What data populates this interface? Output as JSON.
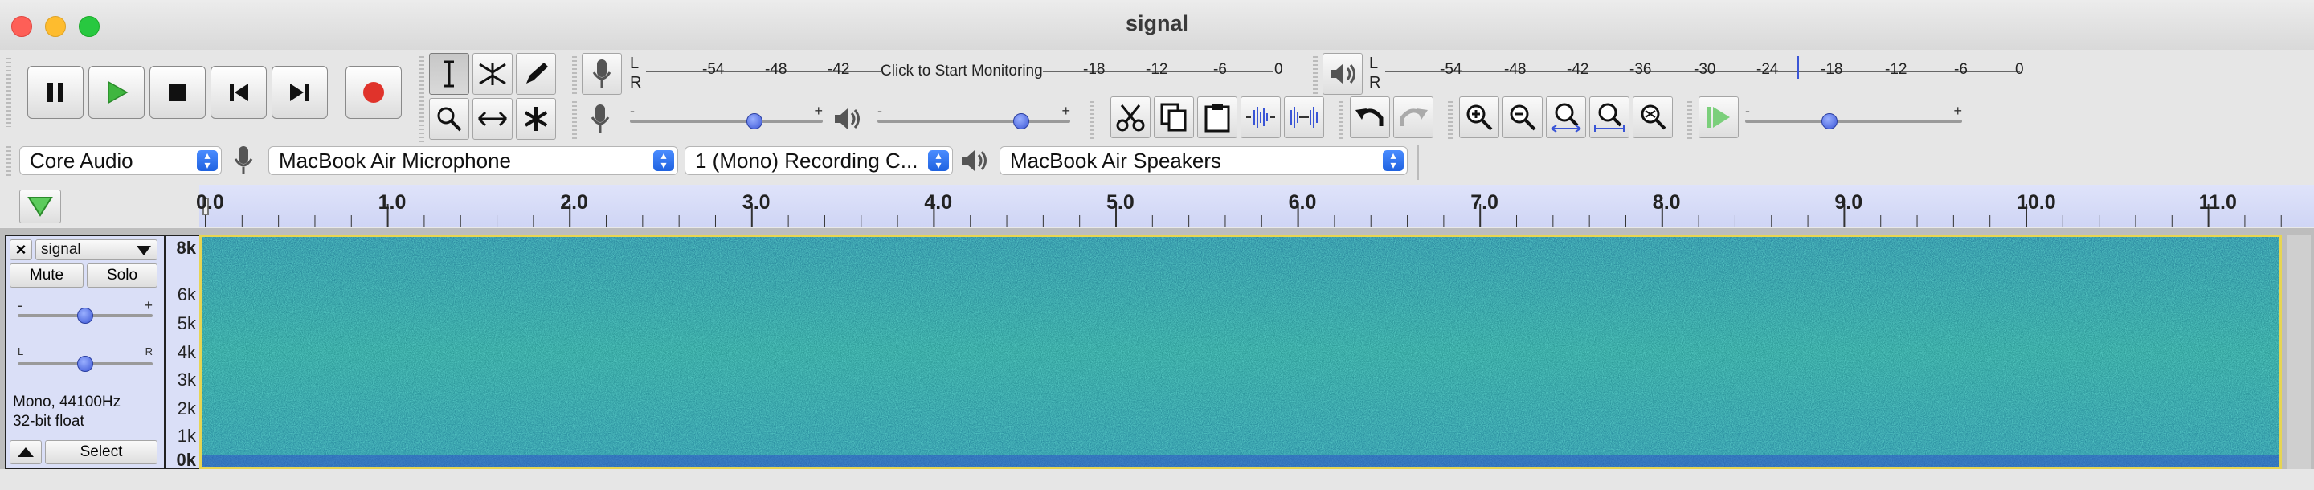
{
  "window": {
    "title": "signal"
  },
  "transport": {
    "pause": "pause-icon",
    "play": "play-icon",
    "stop": "stop-icon",
    "skip_start": "skip-to-start-icon",
    "skip_end": "skip-to-end-icon",
    "record": "record-icon",
    "colors": {
      "play": "#3fb63f",
      "record": "#e0332b"
    }
  },
  "tools": [
    "selection-tool",
    "envelope-tool",
    "draw-tool",
    "zoom-tool",
    "time-shift-tool",
    "multi-tool"
  ],
  "record_meter": {
    "channels": [
      "L",
      "R"
    ],
    "ticks": [
      "-54",
      "-48",
      "-42",
      "-18",
      "-12",
      "-6",
      "0"
    ],
    "monitor_text": "Click to Start Monitoring"
  },
  "play_meter": {
    "channels": [
      "L",
      "R"
    ],
    "ticks": [
      "-54",
      "-48",
      "-42",
      "-36",
      "-30",
      "-24",
      "-18",
      "-12",
      "-6",
      "0"
    ]
  },
  "mixer": {
    "record_volume": {
      "minus": "-",
      "plus": "+",
      "level": 0.66
    },
    "playback_volume": {
      "minus": "-",
      "plus": "+",
      "level": 0.77
    }
  },
  "play_at_speed": {
    "minus": "-",
    "plus": "+",
    "level": 0.38
  },
  "devices": {
    "host": "Core Audio",
    "input": "MacBook Air Microphone",
    "channels": "1 (Mono) Recording C...",
    "output": "MacBook Air Speakers"
  },
  "timeline": {
    "labels": [
      "0.0",
      "1.0",
      "2.0",
      "3.0",
      "4.0",
      "5.0",
      "6.0",
      "7.0",
      "8.0",
      "9.0",
      "10.0",
      "11.0"
    ]
  },
  "track": {
    "name": "signal",
    "mute": "Mute",
    "solo": "Solo",
    "gain": {
      "minus": "-",
      "plus": "+",
      "level": 0.5
    },
    "pan": {
      "left": "L",
      "right": "R",
      "level": 0.5
    },
    "info_line1": "Mono, 44100Hz",
    "info_line2": "32-bit float",
    "select": "Select"
  },
  "freq_scale": [
    "8k",
    "6k",
    "5k",
    "4k",
    "3k",
    "2k",
    "1k",
    "0k"
  ]
}
